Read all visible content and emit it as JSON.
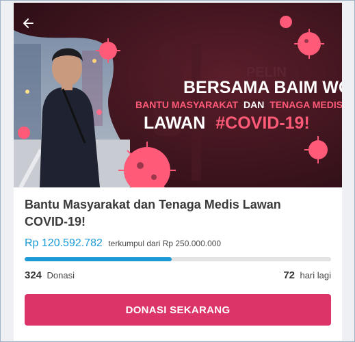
{
  "campaign": {
    "banner": {
      "line1": "BERSAMA BAIM WONG,",
      "line2a": "BANTU MASYARAKAT",
      "line2b": "DAN",
      "line2c": "TENAGA MEDIS",
      "line3a": "LAWAN",
      "line3b": "#COVID-19!",
      "bg_text": "PELIN"
    },
    "title": "Bantu Masyarakat dan Tenaga Medis Lawan COVID-19!",
    "raised_amount": "Rp 120.592.782",
    "raised_suffix": "terkumpul dari Rp 250.000.000",
    "progress_fraction": 0.48,
    "donations_count": "324",
    "donations_label": "Donasi",
    "days_left_count": "72",
    "days_left_label": "hari lagi",
    "donate_button_label": "DONASI SEKARANG"
  },
  "colors": {
    "accent_blue": "#1c9ad6",
    "button_pink": "#dc3369",
    "banner_red": "#ff5a78"
  },
  "icons": {
    "back": "arrow-left-icon",
    "virus": "virus-icon"
  }
}
